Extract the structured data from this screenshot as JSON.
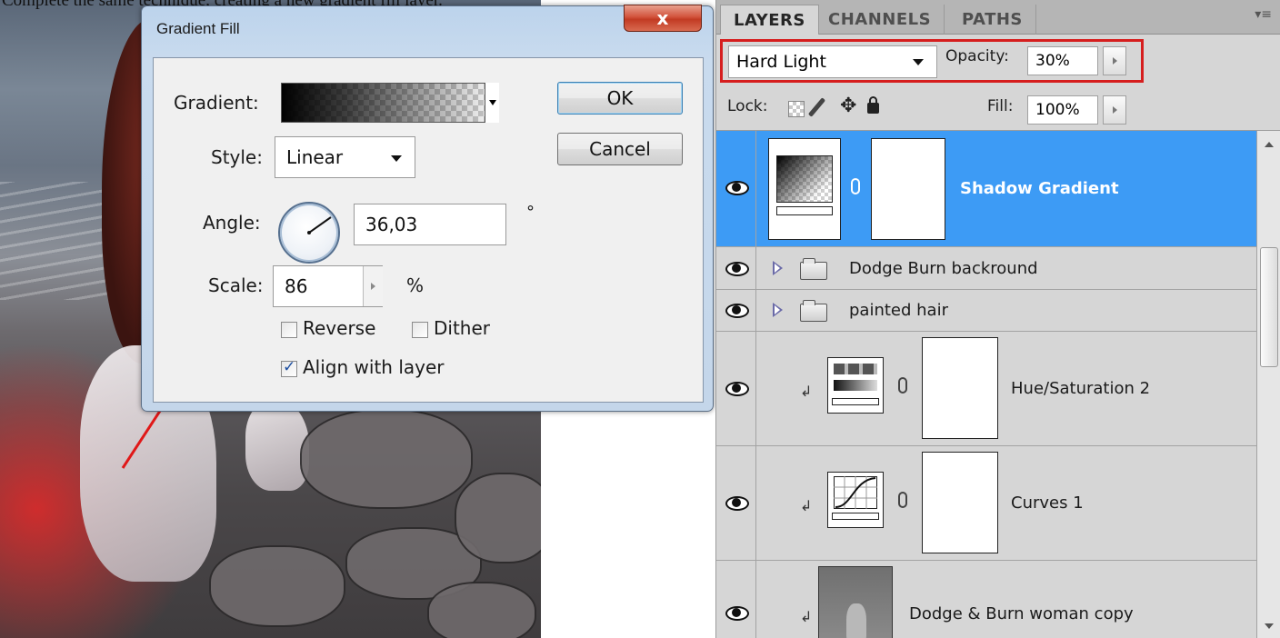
{
  "caption": "Complete the same technique, creating a new gradient fill layer.",
  "dialog": {
    "title": "Gradient Fill",
    "close_label": "x",
    "gradient_label": "Gradient:",
    "style_label": "Style:",
    "style_value": "Linear",
    "angle_label": "Angle:",
    "angle_value": "36,03",
    "degree_symbol": "°",
    "scale_label": "Scale:",
    "scale_value": "86",
    "percent_symbol": "%",
    "reverse_label": "Reverse",
    "reverse_checked": false,
    "dither_label": "Dither",
    "dither_checked": false,
    "align_label": "Align with layer",
    "align_checked": true,
    "ok_label": "OK",
    "cancel_label": "Cancel"
  },
  "panel": {
    "tabs": [
      {
        "label": "LAYERS",
        "active": true
      },
      {
        "label": "CHANNELS",
        "active": false
      },
      {
        "label": "PATHS",
        "active": false
      }
    ],
    "blend_mode": "Hard Light",
    "opacity_label": "Opacity:",
    "opacity_value": "30%",
    "lock_label": "Lock:",
    "fill_label": "Fill:",
    "fill_value": "100%",
    "layers": [
      {
        "name": "Shadow Gradient",
        "selected": true
      },
      {
        "name": "Dodge Burn backround",
        "type": "group"
      },
      {
        "name": "painted hair",
        "type": "group"
      },
      {
        "name": "Hue/Saturation 2",
        "type": "adjustment"
      },
      {
        "name": "Curves 1",
        "type": "adjustment"
      },
      {
        "name": "Dodge & Burn woman copy",
        "type": "pixel"
      }
    ]
  },
  "colors": {
    "selection": "#3d9bf5",
    "highlight_box": "#d61e1e",
    "annotation_line": "#e01818"
  }
}
